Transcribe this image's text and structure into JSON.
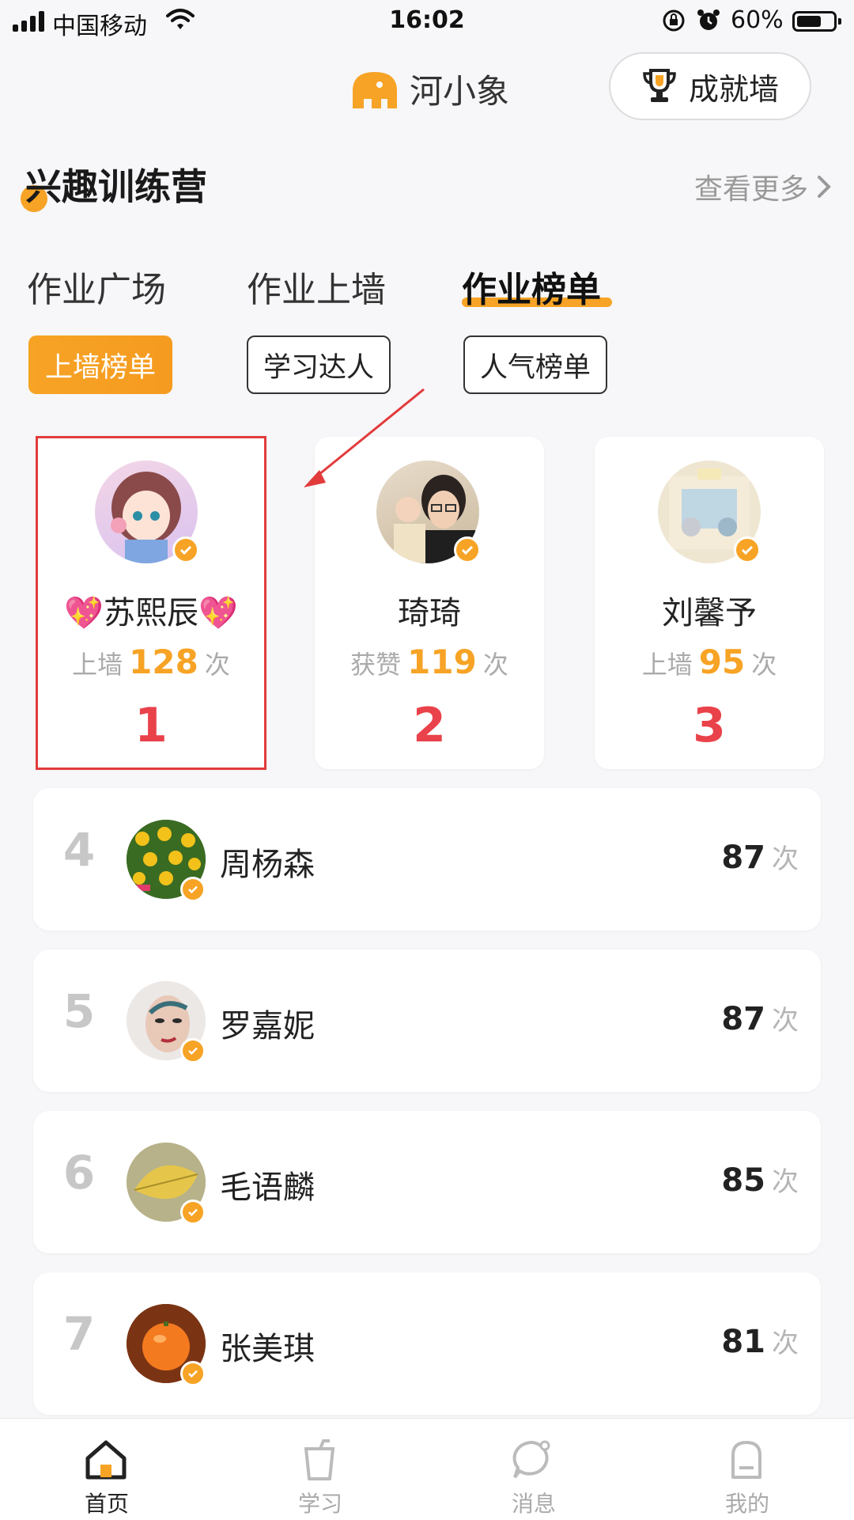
{
  "status_bar": {
    "carrier": "中国移动",
    "time": "16:02",
    "battery_pct": "60%"
  },
  "header": {
    "logo_text": "河小象",
    "achievement_button": "成就墙"
  },
  "section": {
    "title": "兴趣训练营",
    "see_more": "查看更多"
  },
  "tabs": [
    {
      "label": "作业广场",
      "active": false
    },
    {
      "label": "作业上墙",
      "active": false
    },
    {
      "label": "作业榜单",
      "active": true
    }
  ],
  "filters": [
    {
      "label": "上墙榜单",
      "active": true
    },
    {
      "label": "学习达人",
      "active": false
    },
    {
      "label": "人气榜单",
      "active": false
    }
  ],
  "podium": [
    {
      "name": "苏熙辰",
      "name_decor": "💖",
      "stat_label": "上墙",
      "count": "128",
      "unit": "次",
      "rank": "1",
      "avatar_icon": "anime-girl-avatar"
    },
    {
      "name": "琦琦",
      "stat_label": "获赞",
      "count": "119",
      "unit": "次",
      "rank": "2",
      "avatar_icon": "photo-avatar"
    },
    {
      "name": "刘馨予",
      "stat_label": "上墙",
      "count": "95",
      "unit": "次",
      "rank": "3",
      "avatar_icon": "toy-photo-avatar"
    }
  ],
  "ranking_list": [
    {
      "rank": "4",
      "name": "周杨森",
      "count": "87",
      "unit": "次",
      "avatar_icon": "sunflower-avatar"
    },
    {
      "rank": "5",
      "name": "罗嘉妮",
      "count": "87",
      "unit": "次",
      "avatar_icon": "portrait-avatar"
    },
    {
      "rank": "6",
      "name": "毛语麟",
      "count": "85",
      "unit": "次",
      "avatar_icon": "leaf-avatar"
    },
    {
      "rank": "7",
      "name": "张美琪",
      "count": "81",
      "unit": "次",
      "avatar_icon": "orange-avatar"
    }
  ],
  "bottom_nav": [
    {
      "label": "首页",
      "icon": "home-icon",
      "active": true
    },
    {
      "label": "学习",
      "icon": "cup-icon",
      "active": false
    },
    {
      "label": "消息",
      "icon": "message-icon",
      "active": false
    },
    {
      "label": "我的",
      "icon": "profile-icon",
      "active": false
    }
  ],
  "colors": {
    "accent": "#f7a325",
    "rank_red": "#e9424a",
    "highlight_box": "#e23b3b"
  }
}
